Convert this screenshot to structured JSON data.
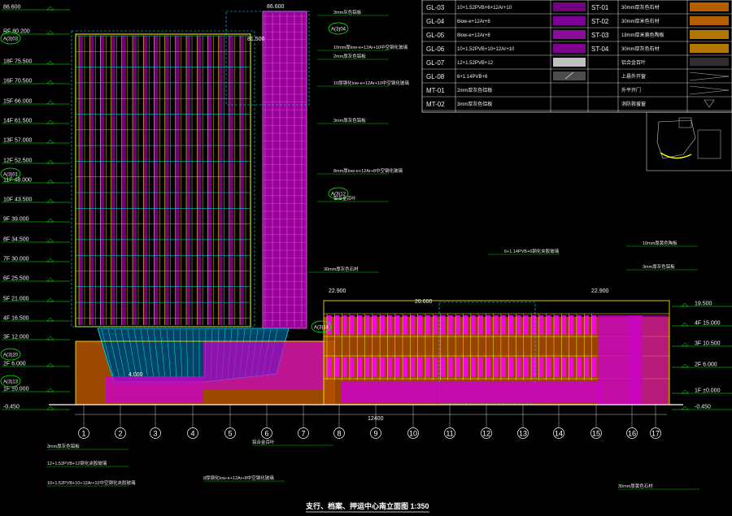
{
  "drawing": {
    "title": "支行、档案、押运中心南立面图 1:350"
  },
  "levels_left": [
    {
      "name": "",
      "value": "86.600"
    },
    {
      "name": "RF",
      "value": "80.200"
    },
    {
      "name": "18F",
      "value": "75.500"
    },
    {
      "name": "16F",
      "value": "70.500"
    },
    {
      "name": "15F",
      "value": "66.000"
    },
    {
      "name": "14F",
      "value": "61.500"
    },
    {
      "name": "13F",
      "value": "57.000"
    },
    {
      "name": "12F",
      "value": "52.500"
    },
    {
      "name": "11F",
      "value": "48.000"
    },
    {
      "name": "10F",
      "value": "43.500"
    },
    {
      "name": "9F",
      "value": "39.000"
    },
    {
      "name": "8F",
      "value": "34.500"
    },
    {
      "name": "7F",
      "value": "30.000"
    },
    {
      "name": "6F",
      "value": "25.500"
    },
    {
      "name": "5F",
      "value": "21.000"
    },
    {
      "name": "4F",
      "value": "16.500"
    },
    {
      "name": "3F",
      "value": "12.000"
    },
    {
      "name": "2F",
      "value": "6.000"
    },
    {
      "name": "1F",
      "value": "±0.000"
    },
    {
      "name": "",
      "value": "-0.450"
    }
  ],
  "levels_right": [
    {
      "name": "",
      "value": "19.500"
    },
    {
      "name": "4F",
      "value": "15.000"
    },
    {
      "name": "3F",
      "value": "10.500"
    },
    {
      "name": "2F",
      "value": "6.000"
    },
    {
      "name": "1F",
      "value": "±0.000"
    },
    {
      "name": "",
      "value": "-0.450"
    }
  ],
  "top_levels": [
    "86.600",
    "81.500",
    "22.900",
    "20.600",
    "22.900"
  ],
  "ground_mark": "4.000",
  "overall_dim": "12400",
  "grid_axes": [
    "1",
    "2",
    "3",
    "4",
    "5",
    "6",
    "7",
    "8",
    "9",
    "10",
    "11",
    "12",
    "13",
    "14",
    "15",
    "16",
    "17"
  ],
  "callouts": [
    "A(3)03",
    "A(3)04",
    "A(3)01",
    "A(3)12",
    "A(3)14",
    "A(3)20",
    "A(3)13"
  ],
  "legend": [
    {
      "code": "GL-03",
      "desc": "10+1.52PVB+6+12Ar+10",
      "code2": "ST-01",
      "desc2": "30mm厚灰色石材"
    },
    {
      "code": "GL-04",
      "desc": "6low-e+12Ar+8",
      "code2": "ST-02",
      "desc2": "30mm厚米色石材"
    },
    {
      "code": "GL-05",
      "desc": "8low-e+12Ar+8",
      "code2": "ST-03",
      "desc2": "18mm厚米黄色陶板"
    },
    {
      "code": "GL-06",
      "desc": "10+1.52PVB+10+12Ar+10",
      "code2": "ST-04",
      "desc2": "30mm厚灰色石材"
    },
    {
      "code": "GL-07",
      "desc": "12+1.52PVB+12",
      "code2": "",
      "desc2": "铝合金百叶"
    },
    {
      "code": "GL-08",
      "desc": "6+1.14PVB+6",
      "code2": "",
      "desc2": "上悬外开窗"
    },
    {
      "code": "MT-01",
      "desc": "2mm厚灰色铝板",
      "code2": "",
      "desc2": "外平开门"
    },
    {
      "code": "MT-02",
      "desc": "3mm厚灰色铝板",
      "code2": "",
      "desc2": "消防救援窗"
    }
  ],
  "annotations_top": [
    "3mm灰色铝板",
    "10mm厚low-e+12Ar+10中空钢化玻璃",
    "2mm厚灰色铝板",
    "10厚钢化low-e+12Ar+10中空钢化玻璃",
    "3mm厚灰色铝板",
    "8mm厚low-e+12Ar+8中空钢化玻璃",
    "铝合金百叶",
    "30mm厚灰色石材",
    "6+1.14PVB+6钢化夹胶玻璃",
    "10mm厚黄色陶板",
    "3mm厚灰色铝板"
  ],
  "annotations_bottom": [
    "3mm厚灰色铝板",
    "12+1.52PVB+12钢化夹胶玻璃",
    "10+1.52PVB+10+12Ar+10中空钢化夹胶玻璃",
    "铝合金百叶",
    "8厚钢化low-e+12Ar+8中空钢化玻璃",
    "30mm厚黄色石材"
  ],
  "colors": {
    "magenta": "#ff00ff",
    "cyan": "#00e5ff",
    "orange": "#ff8000",
    "yellow": "#ffff00",
    "green": "#00ff00",
    "white": "#ffffff"
  }
}
